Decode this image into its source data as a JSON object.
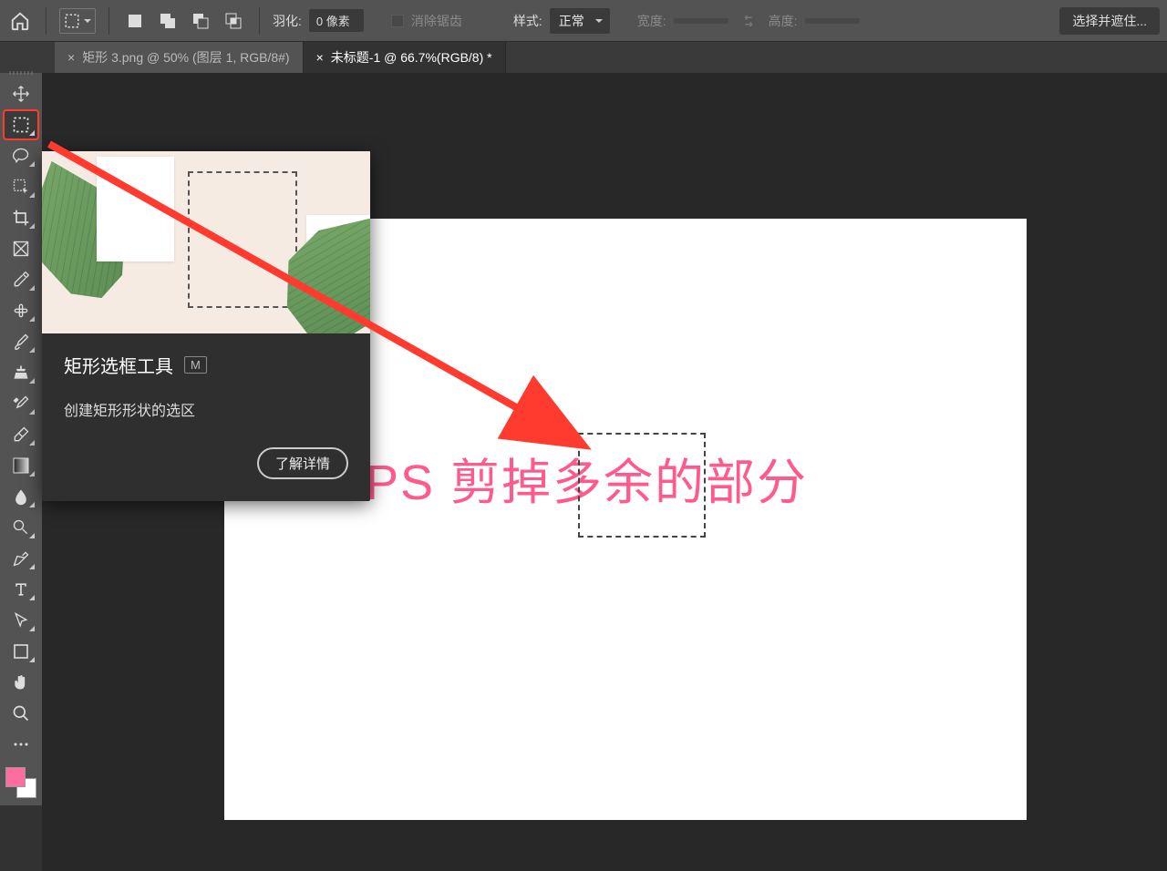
{
  "options_bar": {
    "feather_label": "羽化:",
    "feather_value": "0 像素",
    "antialias_label": "消除锯齿",
    "style_label": "样式:",
    "style_value": "正常",
    "width_label": "宽度:",
    "height_label": "高度:",
    "select_mask_btn": "选择并遮住..."
  },
  "tabs": [
    {
      "label": "矩形 3.png @ 50% (图层 1, RGB/8#)",
      "active": false
    },
    {
      "label": "未标题-1 @ 66.7%(RGB/8) *",
      "active": true
    }
  ],
  "tooltip": {
    "title": "矩形选框工具",
    "shortcut": "M",
    "description": "创建矩形形状的选区",
    "learn_more": "了解详情"
  },
  "canvas": {
    "text": "PS 剪掉多余的部分"
  },
  "tool_names": [
    "move-tool",
    "marquee-tool",
    "lasso-tool",
    "quick-select-tool",
    "crop-tool",
    "frame-tool",
    "eyedropper-tool",
    "healing-brush-tool",
    "brush-tool",
    "clone-stamp-tool",
    "history-brush-tool",
    "eraser-tool",
    "gradient-tool",
    "blur-tool",
    "dodge-tool",
    "pen-tool",
    "type-tool",
    "path-select-tool",
    "rectangle-tool",
    "hand-tool",
    "zoom-tool",
    "more-tool"
  ],
  "colors": {
    "accent_pink": "#ff5a8c",
    "highlight_red": "#ff3b30",
    "fg_swatch": "#ff6da0"
  }
}
